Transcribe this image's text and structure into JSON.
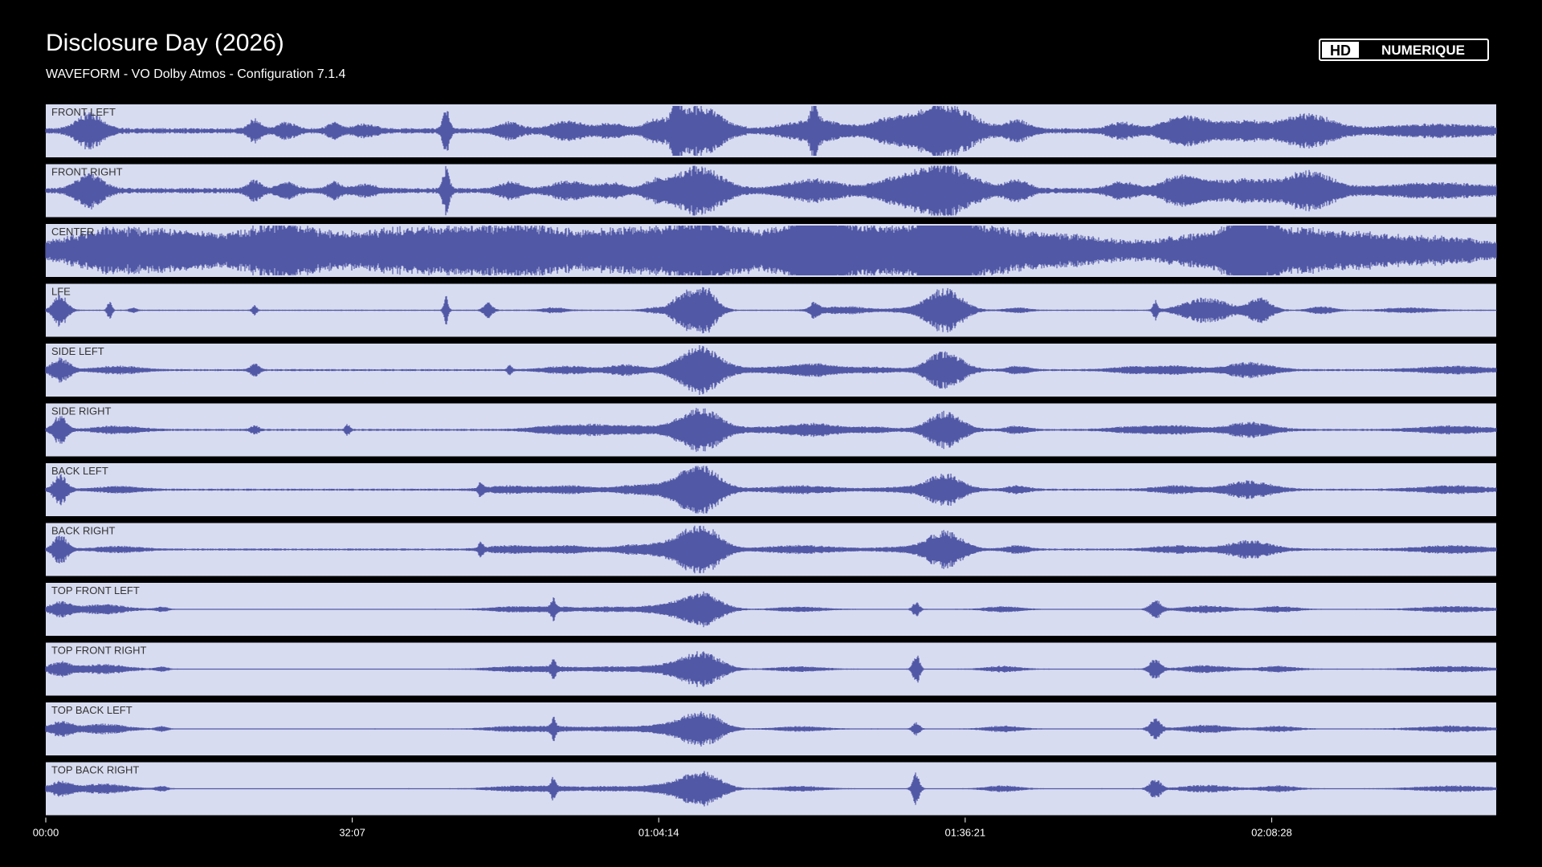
{
  "title": "Disclosure Day (2026)",
  "subtitle": "WAVEFORM - VO Dolby Atmos - Configuration 7.1.4",
  "logo": {
    "text_hd": "HD",
    "text_brand": "NUMERIQUE"
  },
  "colors": {
    "background": "#000000",
    "lane_fill": "#d8dcf0",
    "waveform": "#5158a6",
    "text": "#ffffff",
    "lane_label": "#333333"
  },
  "chart_data": {
    "type": "area",
    "xlabel": "",
    "ylabel": "",
    "xlim": [
      0,
      9120
    ],
    "grid": false,
    "x_ticks": [
      {
        "value": 0,
        "label": "00:00"
      },
      {
        "value": 1927,
        "label": "32:07"
      },
      {
        "value": 3854,
        "label": "01:04:14"
      },
      {
        "value": 5781,
        "label": "01:36:21"
      },
      {
        "value": 7708,
        "label": "02:08:28"
      }
    ],
    "channels": [
      {
        "name": "FRONT LEFT",
        "base": 0.08,
        "events": [
          [
            0.03,
            0.7,
            0.012
          ],
          [
            0.144,
            0.4,
            0.006
          ],
          [
            0.166,
            0.3,
            0.008
          ],
          [
            0.199,
            0.3,
            0.006
          ],
          [
            0.22,
            0.2,
            0.01
          ],
          [
            0.276,
            0.9,
            0.003
          ],
          [
            0.32,
            0.3,
            0.01
          ],
          [
            0.36,
            0.35,
            0.015
          ],
          [
            0.39,
            0.25,
            0.012
          ],
          [
            0.42,
            0.35,
            0.01
          ],
          [
            0.435,
            0.9,
            0.004
          ],
          [
            0.45,
            1.0,
            0.02
          ],
          [
            0.53,
            0.9,
            0.003
          ],
          [
            0.53,
            0.4,
            0.025
          ],
          [
            0.58,
            0.3,
            0.015
          ],
          [
            0.6,
            0.2,
            0.03
          ],
          [
            0.62,
            1.0,
            0.025
          ],
          [
            0.67,
            0.4,
            0.01
          ],
          [
            0.742,
            0.3,
            0.012
          ],
          [
            0.78,
            0.3,
            0.015
          ],
          [
            0.79,
            0.3,
            0.02
          ],
          [
            0.83,
            0.35,
            0.03
          ],
          [
            0.872,
            0.6,
            0.02
          ],
          [
            0.96,
            0.2,
            0.05
          ]
        ]
      },
      {
        "name": "FRONT RIGHT",
        "base": 0.08,
        "events": [
          [
            0.03,
            0.7,
            0.012
          ],
          [
            0.144,
            0.4,
            0.006
          ],
          [
            0.166,
            0.3,
            0.008
          ],
          [
            0.199,
            0.3,
            0.006
          ],
          [
            0.22,
            0.2,
            0.01
          ],
          [
            0.276,
            0.9,
            0.003
          ],
          [
            0.32,
            0.3,
            0.01
          ],
          [
            0.36,
            0.35,
            0.015
          ],
          [
            0.39,
            0.25,
            0.012
          ],
          [
            0.42,
            0.35,
            0.01
          ],
          [
            0.45,
            1.0,
            0.02
          ],
          [
            0.53,
            0.4,
            0.025
          ],
          [
            0.58,
            0.3,
            0.015
          ],
          [
            0.6,
            0.25,
            0.02
          ],
          [
            0.62,
            1.0,
            0.025
          ],
          [
            0.67,
            0.4,
            0.01
          ],
          [
            0.742,
            0.3,
            0.012
          ],
          [
            0.78,
            0.35,
            0.015
          ],
          [
            0.79,
            0.3,
            0.02
          ],
          [
            0.83,
            0.4,
            0.03
          ],
          [
            0.872,
            0.7,
            0.02
          ],
          [
            0.96,
            0.25,
            0.05
          ]
        ]
      },
      {
        "name": "CENTER",
        "base": 0.22,
        "events": [
          [
            0.05,
            0.7,
            0.04
          ],
          [
            0.1,
            0.45,
            0.03
          ],
          [
            0.16,
            0.9,
            0.03
          ],
          [
            0.24,
            0.6,
            0.06
          ],
          [
            0.3,
            0.4,
            0.05
          ],
          [
            0.34,
            0.6,
            0.04
          ],
          [
            0.4,
            0.6,
            0.03
          ],
          [
            0.45,
            1.0,
            0.03
          ],
          [
            0.5,
            0.45,
            0.04
          ],
          [
            0.53,
            0.9,
            0.015
          ],
          [
            0.55,
            0.7,
            0.04
          ],
          [
            0.6,
            0.5,
            0.04
          ],
          [
            0.62,
            1.0,
            0.02
          ],
          [
            0.65,
            0.6,
            0.03
          ],
          [
            0.7,
            0.4,
            0.04
          ],
          [
            0.8,
            0.4,
            0.04
          ],
          [
            0.83,
            0.9,
            0.015
          ],
          [
            0.85,
            0.6,
            0.04
          ],
          [
            0.9,
            0.4,
            0.04
          ],
          [
            0.96,
            0.3,
            0.04
          ]
        ]
      },
      {
        "name": "LFE",
        "base": 0.02,
        "events": [
          [
            0.01,
            0.7,
            0.006
          ],
          [
            0.044,
            0.4,
            0.002
          ],
          [
            0.06,
            0.1,
            0.003
          ],
          [
            0.144,
            0.2,
            0.002
          ],
          [
            0.276,
            0.6,
            0.002
          ],
          [
            0.305,
            0.3,
            0.004
          ],
          [
            0.35,
            0.1,
            0.01
          ],
          [
            0.42,
            0.1,
            0.01
          ],
          [
            0.44,
            0.7,
            0.01
          ],
          [
            0.455,
            0.9,
            0.01
          ],
          [
            0.53,
            0.3,
            0.004
          ],
          [
            0.55,
            0.15,
            0.02
          ],
          [
            0.6,
            0.1,
            0.02
          ],
          [
            0.62,
            0.9,
            0.015
          ],
          [
            0.67,
            0.1,
            0.01
          ],
          [
            0.765,
            0.4,
            0.002
          ],
          [
            0.8,
            0.5,
            0.02
          ],
          [
            0.837,
            0.5,
            0.01
          ],
          [
            0.88,
            0.15,
            0.01
          ],
          [
            0.94,
            0.1,
            0.02
          ]
        ]
      },
      {
        "name": "SIDE LEFT",
        "base": 0.03,
        "events": [
          [
            0.01,
            0.5,
            0.008
          ],
          [
            0.05,
            0.15,
            0.02
          ],
          [
            0.144,
            0.25,
            0.004
          ],
          [
            0.32,
            0.2,
            0.002
          ],
          [
            0.36,
            0.15,
            0.02
          ],
          [
            0.4,
            0.2,
            0.015
          ],
          [
            0.44,
            0.4,
            0.015
          ],
          [
            0.455,
            0.8,
            0.015
          ],
          [
            0.5,
            0.1,
            0.04
          ],
          [
            0.53,
            0.2,
            0.02
          ],
          [
            0.57,
            0.1,
            0.02
          ],
          [
            0.62,
            0.8,
            0.015
          ],
          [
            0.67,
            0.15,
            0.01
          ],
          [
            0.75,
            0.12,
            0.02
          ],
          [
            0.78,
            0.15,
            0.02
          ],
          [
            0.83,
            0.3,
            0.02
          ],
          [
            0.97,
            0.15,
            0.03
          ]
        ]
      },
      {
        "name": "SIDE RIGHT",
        "base": 0.03,
        "events": [
          [
            0.01,
            0.6,
            0.006
          ],
          [
            0.05,
            0.15,
            0.02
          ],
          [
            0.144,
            0.15,
            0.004
          ],
          [
            0.208,
            0.25,
            0.002
          ],
          [
            0.35,
            0.15,
            0.02
          ],
          [
            0.38,
            0.2,
            0.02
          ],
          [
            0.41,
            0.15,
            0.015
          ],
          [
            0.44,
            0.4,
            0.015
          ],
          [
            0.455,
            0.7,
            0.015
          ],
          [
            0.5,
            0.1,
            0.04
          ],
          [
            0.53,
            0.2,
            0.02
          ],
          [
            0.57,
            0.1,
            0.02
          ],
          [
            0.62,
            0.75,
            0.015
          ],
          [
            0.67,
            0.15,
            0.01
          ],
          [
            0.75,
            0.12,
            0.02
          ],
          [
            0.78,
            0.15,
            0.02
          ],
          [
            0.83,
            0.3,
            0.02
          ],
          [
            0.97,
            0.15,
            0.03
          ]
        ]
      },
      {
        "name": "BACK LEFT",
        "base": 0.03,
        "events": [
          [
            0.01,
            0.6,
            0.006
          ],
          [
            0.05,
            0.12,
            0.02
          ],
          [
            0.3,
            0.3,
            0.002
          ],
          [
            0.32,
            0.15,
            0.02
          ],
          [
            0.36,
            0.15,
            0.02
          ],
          [
            0.41,
            0.2,
            0.02
          ],
          [
            0.44,
            0.5,
            0.015
          ],
          [
            0.455,
            0.8,
            0.015
          ],
          [
            0.52,
            0.15,
            0.03
          ],
          [
            0.6,
            0.1,
            0.03
          ],
          [
            0.62,
            0.6,
            0.015
          ],
          [
            0.67,
            0.15,
            0.01
          ],
          [
            0.78,
            0.15,
            0.02
          ],
          [
            0.83,
            0.35,
            0.02
          ],
          [
            0.97,
            0.15,
            0.03
          ]
        ]
      },
      {
        "name": "BACK RIGHT",
        "base": 0.03,
        "events": [
          [
            0.01,
            0.6,
            0.006
          ],
          [
            0.05,
            0.12,
            0.02
          ],
          [
            0.3,
            0.3,
            0.002
          ],
          [
            0.32,
            0.15,
            0.02
          ],
          [
            0.36,
            0.15,
            0.02
          ],
          [
            0.41,
            0.2,
            0.02
          ],
          [
            0.44,
            0.5,
            0.015
          ],
          [
            0.455,
            0.8,
            0.015
          ],
          [
            0.52,
            0.15,
            0.03
          ],
          [
            0.6,
            0.1,
            0.03
          ],
          [
            0.62,
            0.75,
            0.015
          ],
          [
            0.67,
            0.15,
            0.01
          ],
          [
            0.78,
            0.15,
            0.02
          ],
          [
            0.83,
            0.35,
            0.02
          ],
          [
            0.97,
            0.15,
            0.03
          ]
        ]
      },
      {
        "name": "TOP FRONT LEFT",
        "base": 0.015,
        "events": [
          [
            0.01,
            0.3,
            0.01
          ],
          [
            0.04,
            0.2,
            0.02
          ],
          [
            0.08,
            0.1,
            0.005
          ],
          [
            0.32,
            0.1,
            0.02
          ],
          [
            0.35,
            0.1,
            0.02
          ],
          [
            0.35,
            0.4,
            0.002
          ],
          [
            0.39,
            0.1,
            0.02
          ],
          [
            0.42,
            0.12,
            0.015
          ],
          [
            0.44,
            0.3,
            0.015
          ],
          [
            0.455,
            0.6,
            0.015
          ],
          [
            0.52,
            0.1,
            0.02
          ],
          [
            0.6,
            0.3,
            0.003
          ],
          [
            0.66,
            0.12,
            0.015
          ],
          [
            0.765,
            0.4,
            0.005
          ],
          [
            0.8,
            0.15,
            0.02
          ],
          [
            0.85,
            0.12,
            0.015
          ],
          [
            0.97,
            0.12,
            0.03
          ]
        ]
      },
      {
        "name": "TOP FRONT RIGHT",
        "base": 0.015,
        "events": [
          [
            0.01,
            0.3,
            0.01
          ],
          [
            0.04,
            0.2,
            0.02
          ],
          [
            0.08,
            0.1,
            0.005
          ],
          [
            0.32,
            0.1,
            0.02
          ],
          [
            0.35,
            0.1,
            0.02
          ],
          [
            0.35,
            0.4,
            0.002
          ],
          [
            0.39,
            0.1,
            0.02
          ],
          [
            0.42,
            0.12,
            0.015
          ],
          [
            0.44,
            0.3,
            0.015
          ],
          [
            0.455,
            0.6,
            0.015
          ],
          [
            0.52,
            0.1,
            0.02
          ],
          [
            0.6,
            0.65,
            0.003
          ],
          [
            0.66,
            0.12,
            0.015
          ],
          [
            0.765,
            0.4,
            0.005
          ],
          [
            0.8,
            0.15,
            0.02
          ],
          [
            0.85,
            0.12,
            0.015
          ],
          [
            0.97,
            0.12,
            0.03
          ]
        ]
      },
      {
        "name": "TOP BACK LEFT",
        "base": 0.015,
        "events": [
          [
            0.01,
            0.3,
            0.01
          ],
          [
            0.04,
            0.2,
            0.02
          ],
          [
            0.08,
            0.1,
            0.005
          ],
          [
            0.32,
            0.1,
            0.02
          ],
          [
            0.35,
            0.1,
            0.02
          ],
          [
            0.35,
            0.4,
            0.002
          ],
          [
            0.39,
            0.1,
            0.02
          ],
          [
            0.42,
            0.12,
            0.015
          ],
          [
            0.44,
            0.3,
            0.015
          ],
          [
            0.455,
            0.6,
            0.015
          ],
          [
            0.52,
            0.1,
            0.02
          ],
          [
            0.6,
            0.3,
            0.003
          ],
          [
            0.66,
            0.12,
            0.015
          ],
          [
            0.765,
            0.4,
            0.005
          ],
          [
            0.8,
            0.15,
            0.02
          ],
          [
            0.85,
            0.12,
            0.015
          ],
          [
            0.97,
            0.12,
            0.03
          ]
        ]
      },
      {
        "name": "TOP BACK RIGHT",
        "base": 0.015,
        "events": [
          [
            0.01,
            0.3,
            0.01
          ],
          [
            0.04,
            0.2,
            0.02
          ],
          [
            0.08,
            0.1,
            0.005
          ],
          [
            0.32,
            0.1,
            0.02
          ],
          [
            0.35,
            0.1,
            0.02
          ],
          [
            0.35,
            0.4,
            0.002
          ],
          [
            0.39,
            0.1,
            0.02
          ],
          [
            0.42,
            0.12,
            0.015
          ],
          [
            0.44,
            0.3,
            0.015
          ],
          [
            0.455,
            0.6,
            0.015
          ],
          [
            0.52,
            0.1,
            0.02
          ],
          [
            0.6,
            0.65,
            0.003
          ],
          [
            0.66,
            0.12,
            0.015
          ],
          [
            0.765,
            0.4,
            0.005
          ],
          [
            0.8,
            0.15,
            0.02
          ],
          [
            0.85,
            0.12,
            0.015
          ],
          [
            0.97,
            0.12,
            0.03
          ]
        ]
      }
    ]
  }
}
